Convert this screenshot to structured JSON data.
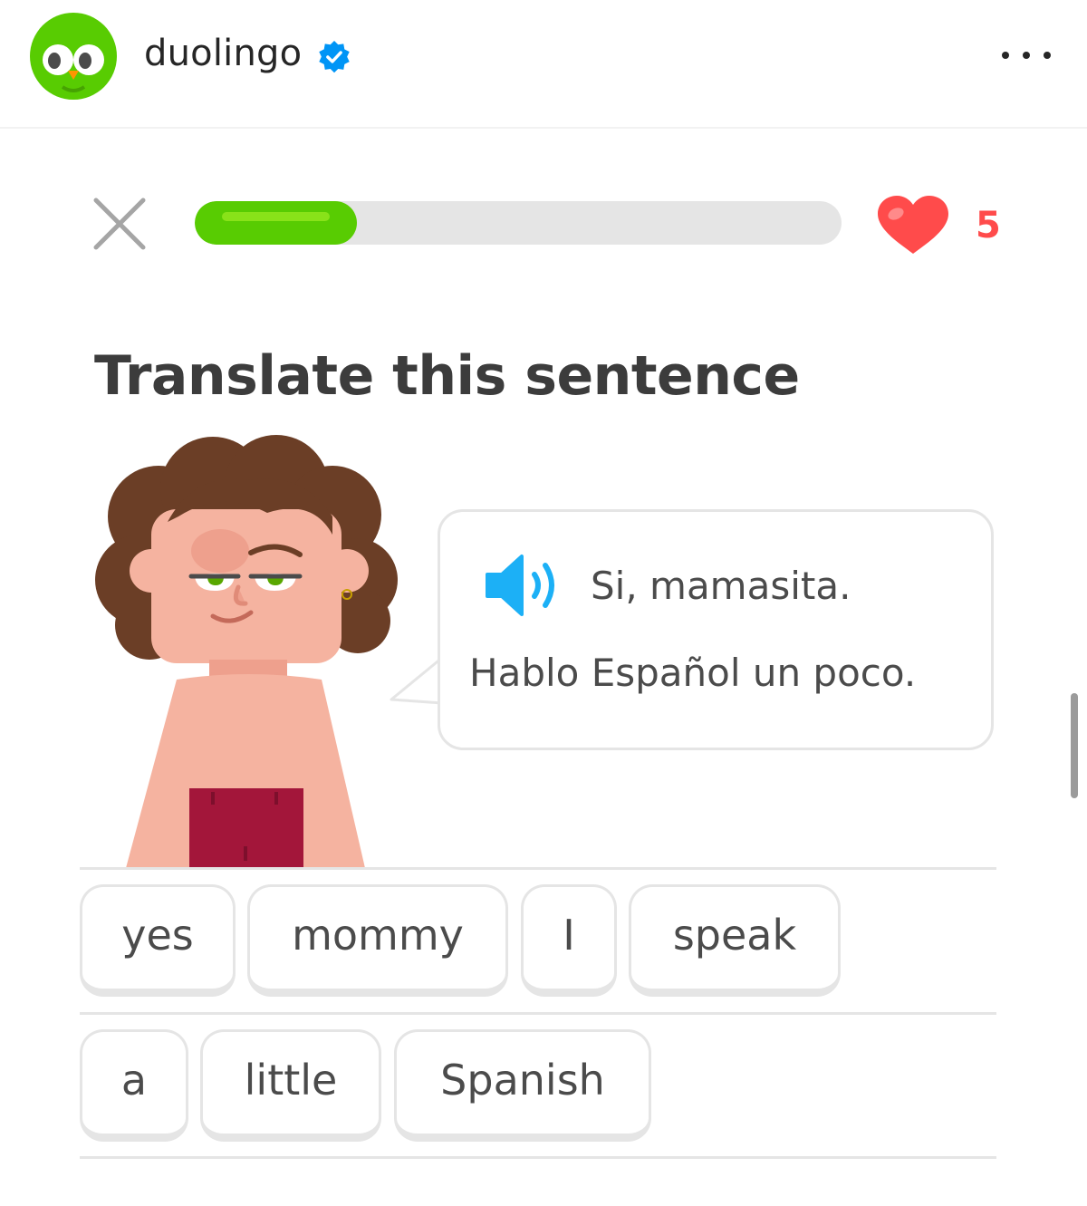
{
  "post": {
    "account_name": "duolingo",
    "verified": true
  },
  "lesson": {
    "progress_percent": 25,
    "hearts": "5",
    "prompt_title": "Translate this sentence",
    "bubble": {
      "line1": "Si, mamasita.",
      "line2": "Hablo Español un poco."
    },
    "word_bank": [
      {
        "label": "yes"
      },
      {
        "label": "mommy"
      },
      {
        "label": "I"
      },
      {
        "label": "speak"
      },
      {
        "label": "a"
      },
      {
        "label": "little"
      },
      {
        "label": "Spanish"
      }
    ]
  },
  "colors": {
    "progress_green": "#58cc02",
    "heart_red": "#ff4b4b",
    "speaker_blue": "#1cb0f6",
    "verified_blue": "#0095f6"
  },
  "icons": {
    "avatar": "duo-owl-icon",
    "verified": "verified-badge-icon",
    "more": "more-dots-icon",
    "close": "close-icon",
    "hearts": "heart-icon",
    "audio": "speaker-icon"
  }
}
